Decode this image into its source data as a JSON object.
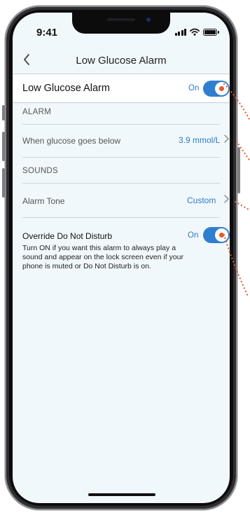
{
  "status_bar": {
    "time": "9:41"
  },
  "nav": {
    "back_icon": "chevron-left-icon",
    "title": "Low Glucose Alarm"
  },
  "main_toggle": {
    "label": "Low Glucose Alarm",
    "state": "On"
  },
  "alarm_section": {
    "header": "ALARM",
    "threshold_label": "When glucose goes below",
    "threshold_value": "3.9 mmol/L"
  },
  "sounds_section": {
    "header": "SOUNDS",
    "tone_label": "Alarm Tone",
    "tone_value": "Custom"
  },
  "override": {
    "label": "Override Do Not Disturb",
    "state": "On",
    "description": "Turn ON if you want this alarm to always play a sound and appear on the lock screen even if your phone is muted or Do Not Disturb is on."
  },
  "colors": {
    "accent": "#2f7fd0",
    "callout_dots": "#e8572a",
    "background": "#f1f8fc"
  }
}
